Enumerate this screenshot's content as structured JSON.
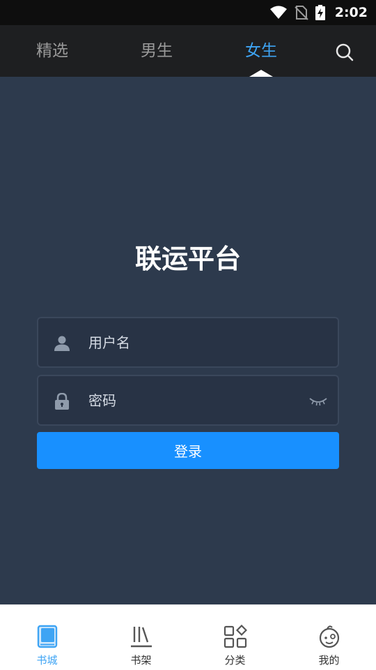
{
  "status_bar": {
    "time": "2:02",
    "icons": [
      "wifi-icon",
      "no-sim-icon",
      "battery-charging-icon"
    ]
  },
  "top_nav": {
    "tabs": [
      {
        "label": "精选",
        "active": false
      },
      {
        "label": "男生",
        "active": false
      },
      {
        "label": "女生",
        "active": true
      }
    ],
    "search_icon": "search-icon"
  },
  "login": {
    "title": "联运平台",
    "username_placeholder": "用户名",
    "password_placeholder": "密码",
    "submit_label": "登录"
  },
  "bottom_nav": {
    "items": [
      {
        "label": "书城",
        "icon": "book-icon",
        "active": true
      },
      {
        "label": "书架",
        "icon": "bookshelf-icon",
        "active": false
      },
      {
        "label": "分类",
        "icon": "category-grid-icon",
        "active": false
      },
      {
        "label": "我的",
        "icon": "profile-avatar-icon",
        "active": false
      }
    ]
  },
  "colors": {
    "accent": "#1890ff",
    "active_tab": "#3ea4f4",
    "background": "#2d3a4d",
    "nav_background": "#1e1f21"
  }
}
